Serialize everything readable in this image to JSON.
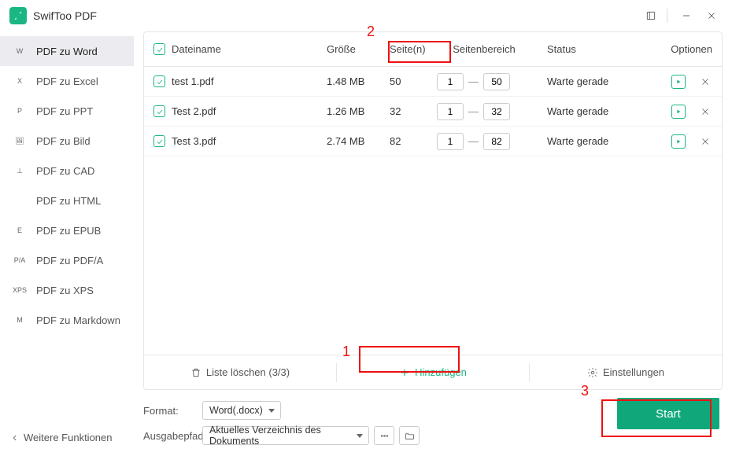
{
  "app_title": "SwifToo PDF",
  "sidebar": {
    "items": [
      {
        "badge": "W",
        "label": "PDF zu Word",
        "active": true
      },
      {
        "badge": "X",
        "label": "PDF zu Excel"
      },
      {
        "badge": "P",
        "label": "PDF zu PPT"
      },
      {
        "badge": "🖼",
        "label": "PDF zu Bild"
      },
      {
        "badge": "⊥",
        "label": "PDF zu CAD"
      },
      {
        "badge": "</>",
        "label": "PDF zu HTML"
      },
      {
        "badge": "E",
        "label": "PDF zu EPUB"
      },
      {
        "badge": "P/A",
        "label": "PDF zu PDF/A"
      },
      {
        "badge": "XPS",
        "label": "PDF zu XPS"
      },
      {
        "badge": "M",
        "label": "PDF zu Markdown"
      }
    ],
    "more": "Weitere Funktionen"
  },
  "table": {
    "headers": {
      "name": "Dateiname",
      "size": "Größe",
      "pages": "Seite(n)",
      "range": "Seitenbereich",
      "status": "Status",
      "options": "Optionen"
    },
    "rows": [
      {
        "name": "test 1.pdf",
        "size": "1.48 MB",
        "pages": "50",
        "from": "1",
        "to": "50",
        "status": "Warte gerade"
      },
      {
        "name": "Test 2.pdf",
        "size": "1.26 MB",
        "pages": "32",
        "from": "1",
        "to": "32",
        "status": "Warte gerade"
      },
      {
        "name": "Test 3.pdf",
        "size": "2.74 MB",
        "pages": "82",
        "from": "1",
        "to": "82",
        "status": "Warte gerade"
      }
    ]
  },
  "toolbar": {
    "clear": "Liste löschen (3/3)",
    "add": "Hinzufügen",
    "settings": "Einstellungen"
  },
  "bottom": {
    "format_label": "Format:",
    "format_value": "Word(.docx)",
    "output_label": "Ausgabepfad:",
    "output_value": "Aktuelles Verzeichnis des Dokuments",
    "start": "Start"
  },
  "annotations": {
    "a1": "1",
    "a2": "2",
    "a3": "3"
  }
}
